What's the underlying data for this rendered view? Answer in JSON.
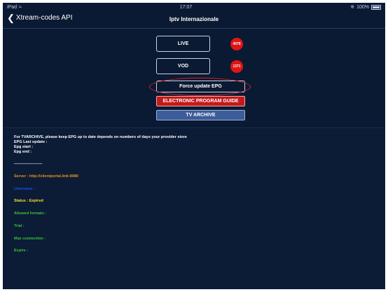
{
  "statusbar": {
    "device": "iPad",
    "time": "17:07",
    "battery": "100%"
  },
  "navbar": {
    "back_label": "Xtream-codes API",
    "title": "Iptv Internazionale"
  },
  "menu": {
    "live_label": "LIVE",
    "live_count": "4078",
    "vod_label": "VOD",
    "vod_count": "1371",
    "force_update_label": "Force update EPG",
    "epg_label": "ELECTRONIC PROGRAM GUIDE",
    "tv_archive_label": "TV ARCHIVE"
  },
  "info": {
    "archive_note": "For TVARCHIVE, please keep EPG up to date depends on numbers of days your provider store",
    "epg_last_update": "EPG Last update  :",
    "epg_start": "Epg start :",
    "epg_end": "Epg end :",
    "separator": "----------------------",
    "server": "Server  : http://clientportal.link:8080",
    "username": "Username  :",
    "status": "Status  : Expired",
    "allowed_formats": "Allowed formats  :",
    "trial": "Trial  :",
    "max_connection": "Max connection  :",
    "expire": "Expire  :"
  },
  "colors": {
    "background": "#0b1a33",
    "live_badge": "#e01515",
    "epg_button": "#c41a1a",
    "archive_button": "#3d5c9a",
    "server_text": "#e89218",
    "username_text": "#1a4fe8",
    "status_text": "#f2e12a",
    "detail_text": "#39c43a"
  }
}
